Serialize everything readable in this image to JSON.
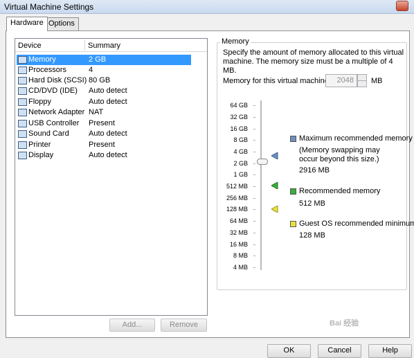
{
  "window": {
    "title": "Virtual Machine Settings"
  },
  "tabs": [
    {
      "label": "Hardware",
      "active": true
    },
    {
      "label": "Options",
      "active": false
    }
  ],
  "device_list": {
    "columns": [
      "Device",
      "Summary"
    ],
    "rows": [
      {
        "name": "Memory",
        "summary": "2 GB",
        "icon": "memory-icon",
        "selected": true
      },
      {
        "name": "Processors",
        "summary": "4",
        "icon": "processor-icon"
      },
      {
        "name": "Hard Disk (SCSI)",
        "summary": "80 GB",
        "icon": "hard-disk-icon"
      },
      {
        "name": "CD/DVD (IDE)",
        "summary": "Auto detect",
        "icon": "cd-dvd-icon"
      },
      {
        "name": "Floppy",
        "summary": "Auto detect",
        "icon": "floppy-icon"
      },
      {
        "name": "Network Adapter",
        "summary": "NAT",
        "icon": "network-adapter-icon"
      },
      {
        "name": "USB Controller",
        "summary": "Present",
        "icon": "usb-icon"
      },
      {
        "name": "Sound Card",
        "summary": "Auto detect",
        "icon": "sound-card-icon"
      },
      {
        "name": "Printer",
        "summary": "Present",
        "icon": "printer-icon"
      },
      {
        "name": "Display",
        "summary": "Auto detect",
        "icon": "display-icon"
      }
    ]
  },
  "list_buttons": {
    "add": "Add...",
    "remove": "Remove"
  },
  "memory_panel": {
    "title": "Memory",
    "description": "Specify the amount of memory allocated to this virtual machine. The memory size must be a multiple of 4 MB.",
    "field_label": "Memory for this virtual machine:",
    "value": "2048",
    "unit": "MB",
    "ticks": [
      "64 GB",
      "32 GB",
      "16 GB",
      "8 GB",
      "4 GB",
      "2 GB",
      "1 GB",
      "512 MB",
      "256 MB",
      "128 MB",
      "64 MB",
      "32 MB",
      "16 MB",
      "8 MB",
      "4 MB"
    ],
    "legend": {
      "maximum": {
        "label": "Maximum recommended memory",
        "note": "(Memory swapping may occur beyond this size.)",
        "value": "2916 MB",
        "color": "#6f8fbf"
      },
      "recommended": {
        "label": "Recommended memory",
        "value": "512 MB",
        "color": "#38b038"
      },
      "guest_min": {
        "label": "Guest OS recommended minimum",
        "value": "128 MB",
        "color": "#e8e23a"
      }
    }
  },
  "footer": {
    "ok": "OK",
    "cancel": "Cancel",
    "help": "Help"
  },
  "watermark": "Bai 经验"
}
